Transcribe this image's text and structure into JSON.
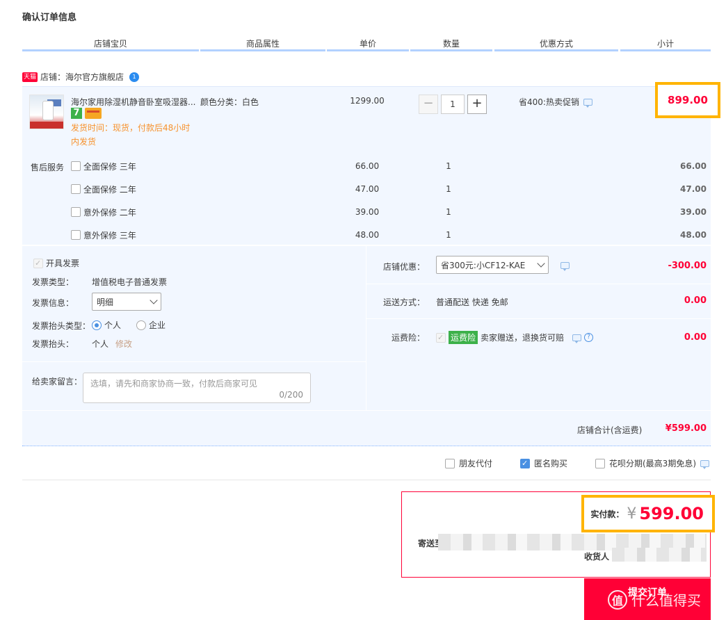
{
  "page_title": "确认订单信息",
  "columns": [
    "店铺宝贝",
    "商品属性",
    "单价",
    "数量",
    "优惠方式",
    "小计"
  ],
  "shop": {
    "tag": "天猫",
    "label": "店铺：海尔官方旗舰店",
    "ww_icon": "1"
  },
  "item": {
    "name": "海尔家用除湿机静音卧室吸湿器...",
    "badge_seven": "7",
    "ship_line1": "发货时间：现货，付款后48小时",
    "ship_line2": "内发货",
    "attr": "颜色分类：白色",
    "price": "1299.00",
    "qty": "1",
    "qty_minus": "−",
    "qty_plus": "+",
    "promo": "省400:热卖促销",
    "subtotal": "899.00"
  },
  "service_label": "售后服务",
  "services": [
    {
      "name": "全面保修 三年",
      "price": "66.00",
      "qty": "1",
      "subtotal": "66.00"
    },
    {
      "name": "全面保修 二年",
      "price": "47.00",
      "qty": "1",
      "subtotal": "47.00"
    },
    {
      "name": "意外保修 二年",
      "price": "39.00",
      "qty": "1",
      "subtotal": "39.00"
    },
    {
      "name": "意外保修 三年",
      "price": "48.00",
      "qty": "1",
      "subtotal": "48.00"
    }
  ],
  "invoice": {
    "open_label": "开具发票",
    "type_label": "发票类型：",
    "type_value": "增值税电子普通发票",
    "info_label": "发票信息：",
    "info_value": "明细",
    "header_type_label": "发票抬头类型：",
    "opt_personal": "个人",
    "opt_company": "企业",
    "header_label": "发票抬头：",
    "header_value": "个人",
    "modify": "修改"
  },
  "message": {
    "label": "给卖家留言：",
    "placeholder": "选填，请先和商家协商一致，付款后商家可见",
    "counter": "0/200"
  },
  "shop_discount": {
    "label": "店铺优惠：",
    "value": "省300元:小CF12-KAE",
    "amount": "-300.00"
  },
  "shipping": {
    "label": "运送方式：",
    "value": "普通配送 快递 免邮",
    "amount": "0.00"
  },
  "insurance": {
    "label": "运费险：",
    "tag": "运费险",
    "value": "卖家赠送，退换货可赔",
    "help": "?",
    "amount": "0.00"
  },
  "shop_total": {
    "label": "店铺合计(含运费)",
    "value": "¥599.00"
  },
  "options": [
    {
      "label": "朋友代付",
      "checked": false
    },
    {
      "label": "匿名购买",
      "checked": true
    },
    {
      "label": "花呗分期(最高3期免息)",
      "checked": false
    }
  ],
  "payment": {
    "label": "实付款：",
    "currency": "¥",
    "amount": "599.00",
    "ship_to_label": "寄送至",
    "receiver_label": "收货人"
  },
  "submit_label": "提交订单",
  "watermark": {
    "icon": "值",
    "text": "什么值得买"
  }
}
